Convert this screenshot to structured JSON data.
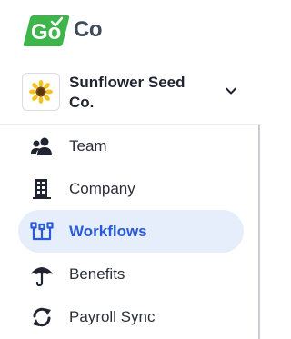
{
  "brand": {
    "logo_go": "Go",
    "logo_co": "Co",
    "accent_green": "#3db54a",
    "accent_blue": "#2a5bd7"
  },
  "company_switcher": {
    "name": "Sunflower Seed Co.",
    "avatar_icon": "sunflower-icon",
    "chevron_icon": "chevron-down-icon"
  },
  "nav": {
    "items": [
      {
        "label": "Team",
        "icon": "team-icon",
        "active": false
      },
      {
        "label": "Company",
        "icon": "building-icon",
        "active": false
      },
      {
        "label": "Workflows",
        "icon": "workflows-icon",
        "active": true
      },
      {
        "label": "Benefits",
        "icon": "umbrella-icon",
        "active": false
      },
      {
        "label": "Payroll Sync",
        "icon": "sync-icon",
        "active": false
      }
    ]
  }
}
